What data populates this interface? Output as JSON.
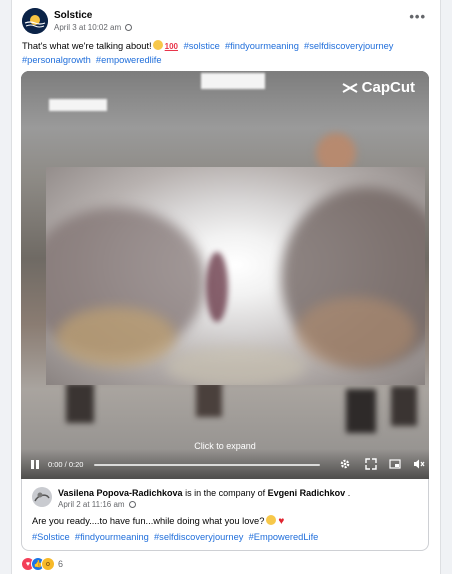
{
  "post": {
    "page_name": "Solstice",
    "date": "April 3 at 10:02 am",
    "more_icon": "more-horizontal-icon",
    "caption_text": "That's what we're talking about!",
    "caption_emojis": [
      "grinning-face-emoji",
      "hundred-points-emoji"
    ],
    "hashtags": [
      "#solstice",
      "#findyourmeaning",
      "#selfdiscoveryjourney",
      "#personalgrowth",
      "#empoweredlife"
    ]
  },
  "video": {
    "watermark": "CapCut",
    "expand_label": "Click to expand",
    "time": "0:00 / 0:20",
    "progress": 0
  },
  "shared": {
    "author": "Vasilena Popova-Radichkova",
    "with_text": "is in the company of",
    "tagged": "Evgeni Radichkov",
    "tail": ".",
    "date": "April 2 at 11:16 am",
    "text": "Are you ready....to have fun...while doing what you love?",
    "text_emojis": [
      "winking-face-emoji",
      "red-heart-emoji"
    ],
    "hashtags": [
      "#Solstice",
      "#findyourmeaning",
      "#selfdiscoveryjourney",
      "#EmpoweredLife"
    ]
  },
  "reactions": {
    "types": [
      "love-reaction-icon",
      "like-reaction-icon",
      "wow-reaction-icon"
    ],
    "count": "6"
  },
  "colors": {
    "link": "#216fdb",
    "secondary_text": "#65676b",
    "love": "#f33e58",
    "like": "#1b74e4",
    "wow": "#f7b928"
  }
}
